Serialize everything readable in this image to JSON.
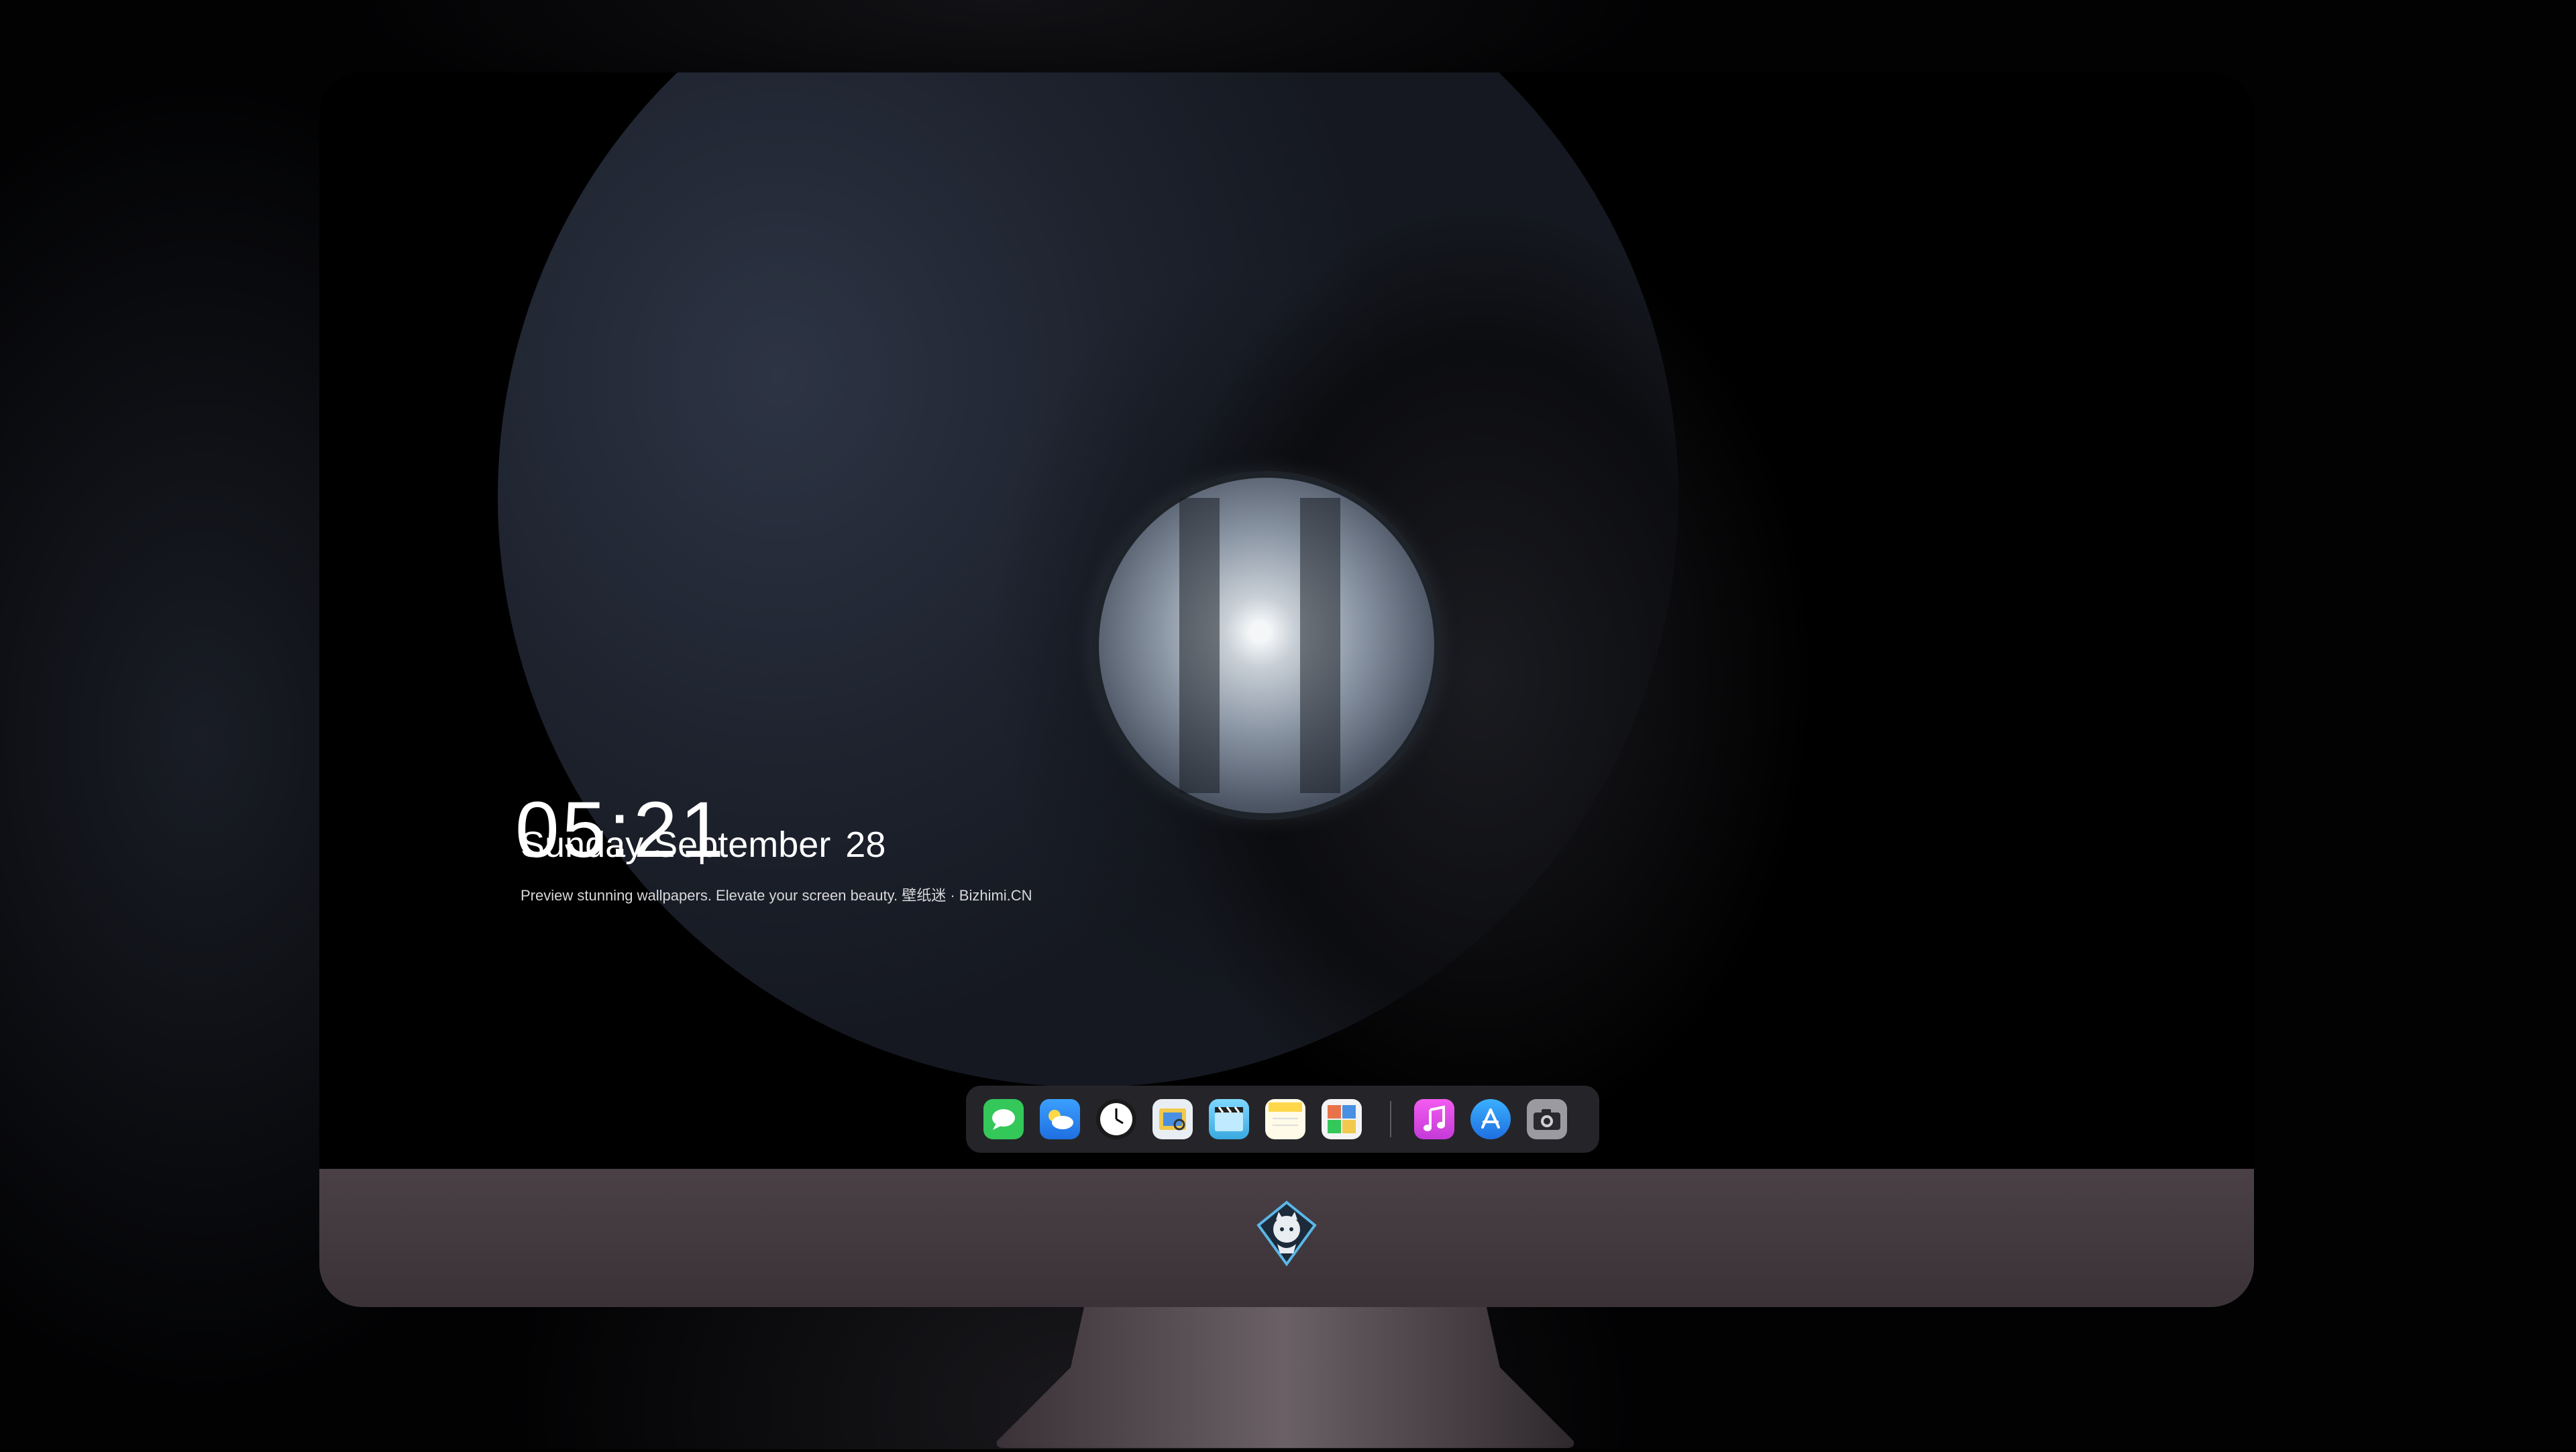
{
  "lock_screen": {
    "time": "05:21",
    "date_day": "Sunday September",
    "date_num": "28",
    "tagline": "Preview stunning wallpapers. Elevate your screen beauty. 壁纸迷 · Bizhimi.CN"
  },
  "dock": {
    "items": [
      {
        "name": "messages-icon",
        "color": "#34c759"
      },
      {
        "name": "weather-icon",
        "color": "#2f8cf0"
      },
      {
        "name": "clock-icon",
        "color": "#ffffff"
      },
      {
        "name": "preview-icon",
        "color": "#f2c94c"
      },
      {
        "name": "videos-icon",
        "color": "#5ac8fa"
      },
      {
        "name": "notes-icon",
        "color": "#ffd84a"
      },
      {
        "name": "photo-booth-icon",
        "color": "#e8734a"
      },
      {
        "name": "music-icon",
        "color": "#e04fd6"
      },
      {
        "name": "app-store-icon",
        "color": "#1f8cf0"
      },
      {
        "name": "camera-icon",
        "color": "#8e8e93"
      }
    ]
  },
  "colors": {
    "monitor_chin": "#453c41",
    "dock_bg": "#28282c"
  }
}
